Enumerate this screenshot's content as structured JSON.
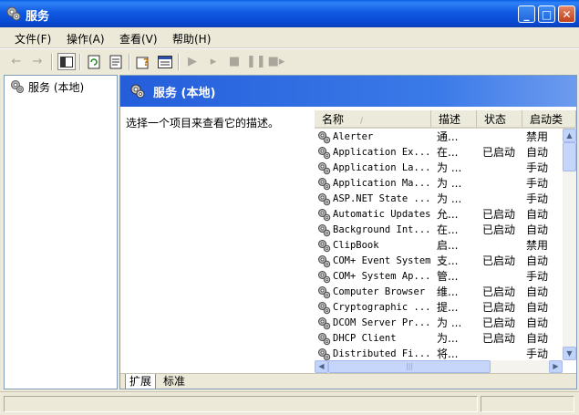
{
  "window": {
    "title": "服务",
    "buttons": {
      "minimize": "_",
      "maximize": "□",
      "close": "✕"
    }
  },
  "menu": [
    "文件(F)",
    "操作(A)",
    "查看(V)",
    "帮助(H)"
  ],
  "toolbar_icons": [
    "back-arrow-icon",
    "forward-arrow-icon",
    "show-hide-tree-icon",
    "refresh-icon",
    "export-list-icon",
    "help-icon",
    "properties-icon",
    "start-service-icon",
    "start-service-icon",
    "stop-service-icon",
    "pause-service-icon",
    "restart-service-icon"
  ],
  "tree": {
    "root_label": "服务 (本地)"
  },
  "pane": {
    "header": "服务 (本地)",
    "description": "选择一个项目来查看它的描述。"
  },
  "columns": {
    "name": "名称",
    "desc": "描述",
    "status": "状态",
    "startup": "启动类"
  },
  "services": [
    {
      "name": "Alerter",
      "desc": "通...",
      "status": "",
      "startup": "禁用"
    },
    {
      "name": "Application Ex...",
      "desc": "在...",
      "status": "已启动",
      "startup": "自动"
    },
    {
      "name": "Application La...",
      "desc": "为 ...",
      "status": "",
      "startup": "手动"
    },
    {
      "name": "Application Ma...",
      "desc": "为 ...",
      "status": "",
      "startup": "手动"
    },
    {
      "name": "ASP.NET State ...",
      "desc": "为 ...",
      "status": "",
      "startup": "手动"
    },
    {
      "name": "Automatic Updates",
      "desc": "允...",
      "status": "已启动",
      "startup": "自动"
    },
    {
      "name": "Background Int...",
      "desc": "在...",
      "status": "已启动",
      "startup": "自动"
    },
    {
      "name": "ClipBook",
      "desc": "启...",
      "status": "",
      "startup": "禁用"
    },
    {
      "name": "COM+ Event System",
      "desc": "支...",
      "status": "已启动",
      "startup": "自动"
    },
    {
      "name": "COM+ System Ap...",
      "desc": "管...",
      "status": "",
      "startup": "手动"
    },
    {
      "name": "Computer Browser",
      "desc": "维...",
      "status": "已启动",
      "startup": "自动"
    },
    {
      "name": "Cryptographic ...",
      "desc": "提...",
      "status": "已启动",
      "startup": "自动"
    },
    {
      "name": "DCOM Server Pr...",
      "desc": "为 ...",
      "status": "已启动",
      "startup": "自动"
    },
    {
      "name": "DHCP Client",
      "desc": "为...",
      "status": "已启动",
      "startup": "自动"
    },
    {
      "name": "Distributed Fi...",
      "desc": "将...",
      "status": "",
      "startup": "手动"
    }
  ],
  "tabs": [
    "扩展",
    "标准"
  ]
}
